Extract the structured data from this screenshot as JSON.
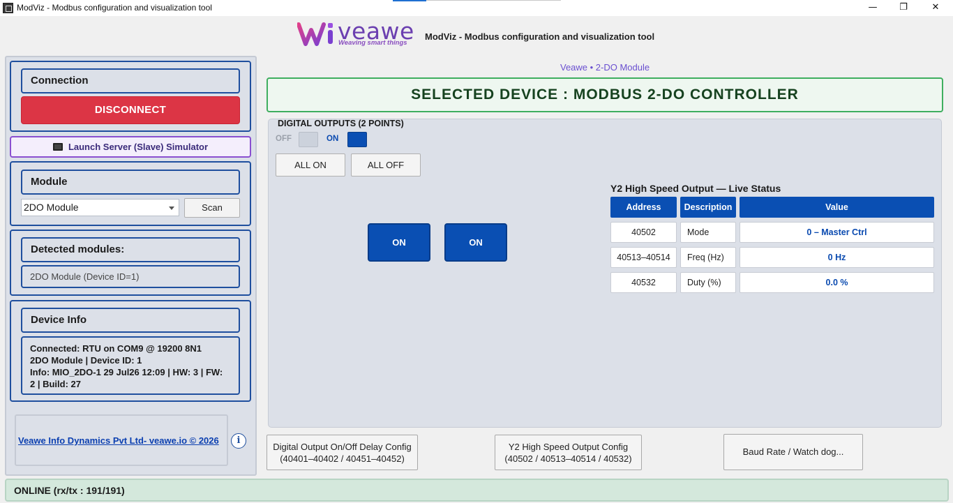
{
  "window": {
    "title": "ModViz - Modbus configuration and visualization tool",
    "minimize_glyph": "—",
    "restore_glyph": "❐",
    "close_glyph": "✕"
  },
  "header": {
    "logo_text": "veawe",
    "logo_tagline": "Weaving smart things",
    "title": "ModViz - Modbus configuration and visualization tool",
    "device_subtitle": "Veawe • 2-DO Module"
  },
  "sidebar": {
    "connection": {
      "heading": "Connection",
      "disconnect_label": "DISCONNECT"
    },
    "simulator_label": "Launch Server (Slave) Simulator",
    "module": {
      "heading": "Module",
      "selected": "2DO Module",
      "scan_label": "Scan"
    },
    "detected": {
      "heading": "Detected modules:",
      "items": [
        "2DO Module (Device ID=1)"
      ]
    },
    "device_info": {
      "heading": "Device Info",
      "line1": "Connected: RTU on COM9 @ 19200 8N1",
      "line2": "2DO Module | Device ID: 1",
      "line3": "Info: MIO_2DO-1  29 Jul26 12:09 | HW: 3 | FW:",
      "line4": "2 | Build: 27"
    },
    "company_link": "Veawe Info Dynamics Pvt Ltd- veawe.io © 2026",
    "info_glyph": "i"
  },
  "main": {
    "banner": "SELECTED DEVICE : MODBUS 2-DO CONTROLLER",
    "digital_outputs": {
      "title": "DIGITAL OUTPUTS (2 POINTS)",
      "legend_off": "OFF",
      "legend_on": "ON",
      "all_on_label": "ALL ON",
      "all_off_label": "ALL OFF",
      "outputs": [
        {
          "label": "ON",
          "state": "on"
        },
        {
          "label": "ON",
          "state": "on"
        }
      ]
    },
    "live_status": {
      "title": "Y2 High Speed Output — Live Status",
      "columns": [
        "Address",
        "Description",
        "Value"
      ],
      "rows": [
        {
          "address": "40502",
          "description": "Mode",
          "value": "0 – Master Ctrl"
        },
        {
          "address": "40513–40514",
          "description": "Freq (Hz)",
          "value": "0 Hz"
        },
        {
          "address": "40532",
          "description": "Duty (%)",
          "value": "0.0 %"
        }
      ]
    },
    "config_buttons": {
      "delay_line1": "Digital Output On/Off Delay Config",
      "delay_line2": "(40401–40402 / 40451–40452)",
      "highspeed_line1": "Y2 High Speed Output Config",
      "highspeed_line2": "(40502  /  40513–40514  /  40532)",
      "baud_label": "Baud Rate / Watch dog..."
    }
  },
  "status_bar": {
    "text": "ONLINE (rx/tx : 191/191)"
  },
  "colors": {
    "accent_blue": "#0a4fb3",
    "disconnect_red": "#dc3545",
    "banner_green": "#3fae5f",
    "brand_purple": "#6b3fb0"
  }
}
